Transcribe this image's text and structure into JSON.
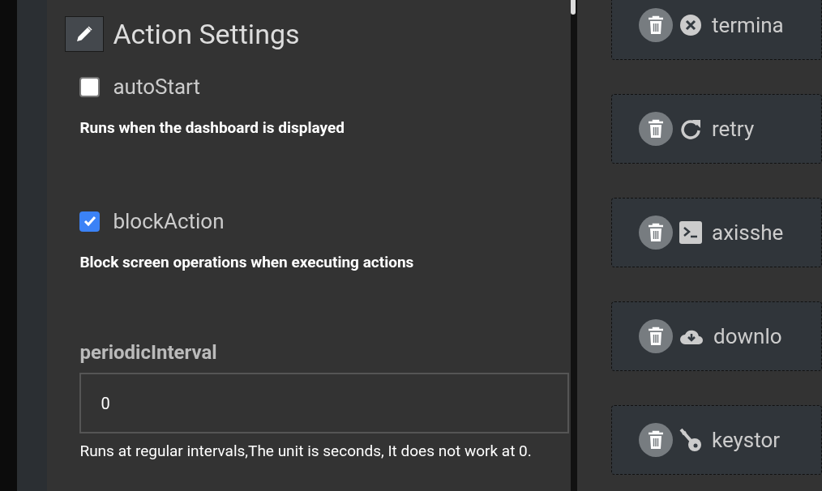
{
  "settings": {
    "title": "Action Settings",
    "options": [
      {
        "kind": "checkbox",
        "label": "autoStart",
        "checked": false,
        "description": "Runs when the dashboard is displayed"
      },
      {
        "kind": "checkbox",
        "label": "blockAction",
        "checked": true,
        "description": "Block screen operations when executing actions"
      },
      {
        "kind": "number",
        "label": "periodicInterval",
        "value": "0",
        "description": "Runs at regular intervals,The unit is seconds, It does not work at 0."
      }
    ]
  },
  "actions": [
    {
      "kind": "close",
      "label": "termina"
    },
    {
      "kind": "retry",
      "label": "retry"
    },
    {
      "kind": "terminal",
      "label": "axisshe"
    },
    {
      "kind": "download",
      "label": "downlo"
    },
    {
      "kind": "key",
      "label": "keystor"
    }
  ]
}
